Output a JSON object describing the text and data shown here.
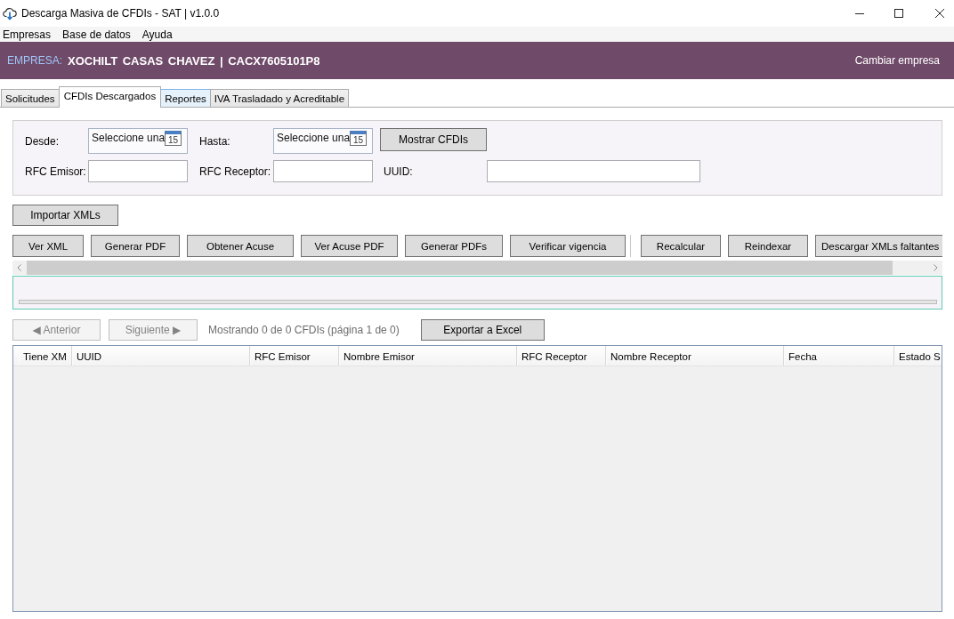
{
  "window": {
    "title": "Descarga Masiva de CFDIs - SAT | v1.0.0"
  },
  "menu_bar": {
    "items": [
      "Empresas",
      "Base de datos",
      "Ayuda"
    ]
  },
  "company_bar": {
    "label": "EMPRESA:",
    "company": "XOCHILT CASAS CHAVEZ | CACX7605101P8",
    "action": "Cambiar empresa"
  },
  "tabs": [
    {
      "label": "Solicitudes",
      "selected": false,
      "hovered": false
    },
    {
      "label": "CFDIs Descargados",
      "selected": true,
      "hovered": false
    },
    {
      "label": "Reportes",
      "selected": false,
      "hovered": true
    },
    {
      "label": "IVA Trasladado y Acreditable",
      "selected": false,
      "hovered": false
    }
  ],
  "filters": {
    "rows": [
      [
        {
          "kind": "date",
          "label": "Desde:",
          "placeholder": "Seleccione una",
          "calendar_day": "15"
        },
        {
          "kind": "date",
          "label": "Hasta:",
          "placeholder": "Seleccione una",
          "calendar_day": "15"
        },
        {
          "kind": "button",
          "label": "Mostrar CFDIs"
        }
      ],
      [
        {
          "kind": "text",
          "label": "RFC Emisor:"
        },
        {
          "kind": "text",
          "label": "RFC Receptor:"
        },
        {
          "kind": "text",
          "label": "UUID:"
        }
      ]
    ]
  },
  "import_button": "Importar XMLs",
  "toolbar": {
    "items": [
      {
        "kind": "button",
        "label": "Ver XML"
      },
      {
        "kind": "button",
        "label": "Generar PDF"
      },
      {
        "kind": "button",
        "label": "Obtener Acuse"
      },
      {
        "kind": "button",
        "label": "Ver Acuse PDF"
      },
      {
        "kind": "button",
        "label": "Generar PDFs"
      },
      {
        "kind": "button",
        "label": "Verificar vigencia"
      },
      {
        "kind": "separator"
      },
      {
        "kind": "button",
        "label": "Recalcular"
      },
      {
        "kind": "button",
        "label": "Reindexar"
      },
      {
        "kind": "button",
        "label": "Descargar XMLs faltantes"
      }
    ]
  },
  "progress": {
    "level": 0
  },
  "pagination": {
    "previous": {
      "label": "◀ Anterior",
      "disabled": true
    },
    "next": {
      "label": "Siguiente ▶",
      "disabled": true
    },
    "status": "Mostrando 0 de 0 CFDIs (página 1 de 0)",
    "export": "Exportar a Excel"
  },
  "table": {
    "columns": [
      "Tiene XM",
      "UUID",
      "RFC Emisor",
      "Nombre Emisor",
      "RFC Receptor",
      "Nombre Receptor",
      "Fecha",
      "Estado S"
    ]
  }
}
